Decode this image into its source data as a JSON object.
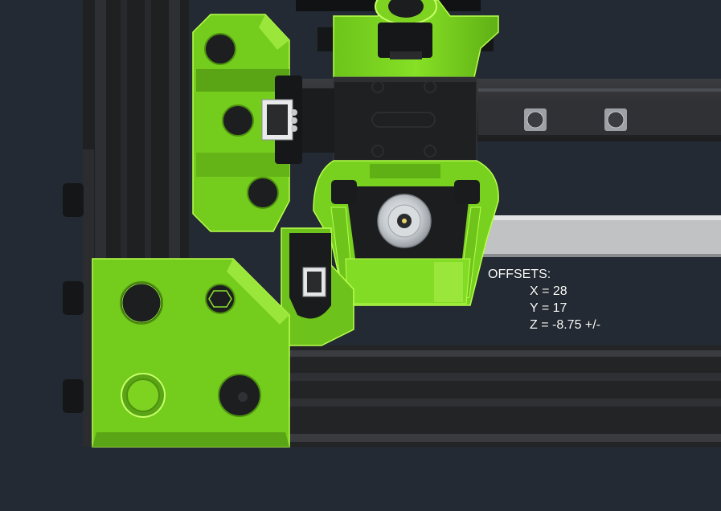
{
  "offsets": {
    "heading": "OFFSETS:",
    "x": "X = 28",
    "y": "Y = 17",
    "z": "Z = -8.75 +/-"
  },
  "colors": {
    "background": "#232a33",
    "printed_part": "#7ed321",
    "part_edge": "#b8ff4d",
    "extrusion": "#2a2c2f",
    "carriage": "#1e1f21",
    "bearing": "#c9ced3"
  },
  "icons": [
    "bearing-icon",
    "bolt-head-icon",
    "hex-nut-icon",
    "switch-icon"
  ]
}
